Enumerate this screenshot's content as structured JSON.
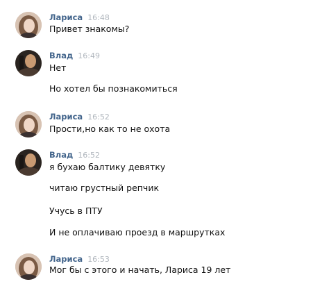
{
  "messages": [
    {
      "author": "Лариса",
      "time": "16:48",
      "avatar_icon": "girl-avatar-photo",
      "lines": [
        "Привет знакомы?"
      ]
    },
    {
      "author": "Влад",
      "time": "16:49",
      "avatar_icon": "boy-avatar-photo",
      "lines": [
        "Нет",
        "Но хотел бы познакомиться"
      ]
    },
    {
      "author": "Лариса",
      "time": "16:52",
      "avatar_icon": "girl-avatar-photo",
      "lines": [
        "Прости,но как то не охота"
      ]
    },
    {
      "author": "Влад",
      "time": "16:52",
      "avatar_icon": "boy-avatar-photo",
      "lines": [
        "я бухаю балтику девятку",
        "читаю грустный репчик",
        "Учусь в ПТУ",
        "И не оплачиваю проезд в маршрутках"
      ]
    },
    {
      "author": "Лариса",
      "time": "16:53",
      "avatar_icon": "girl-avatar-photo",
      "lines": [
        "Мог бы с этого и начать, Лариса 19 лет"
      ]
    }
  ],
  "colors": {
    "author": "#42648b",
    "time": "#b0b6bd",
    "text": "#111111",
    "background": "#ffffff"
  }
}
